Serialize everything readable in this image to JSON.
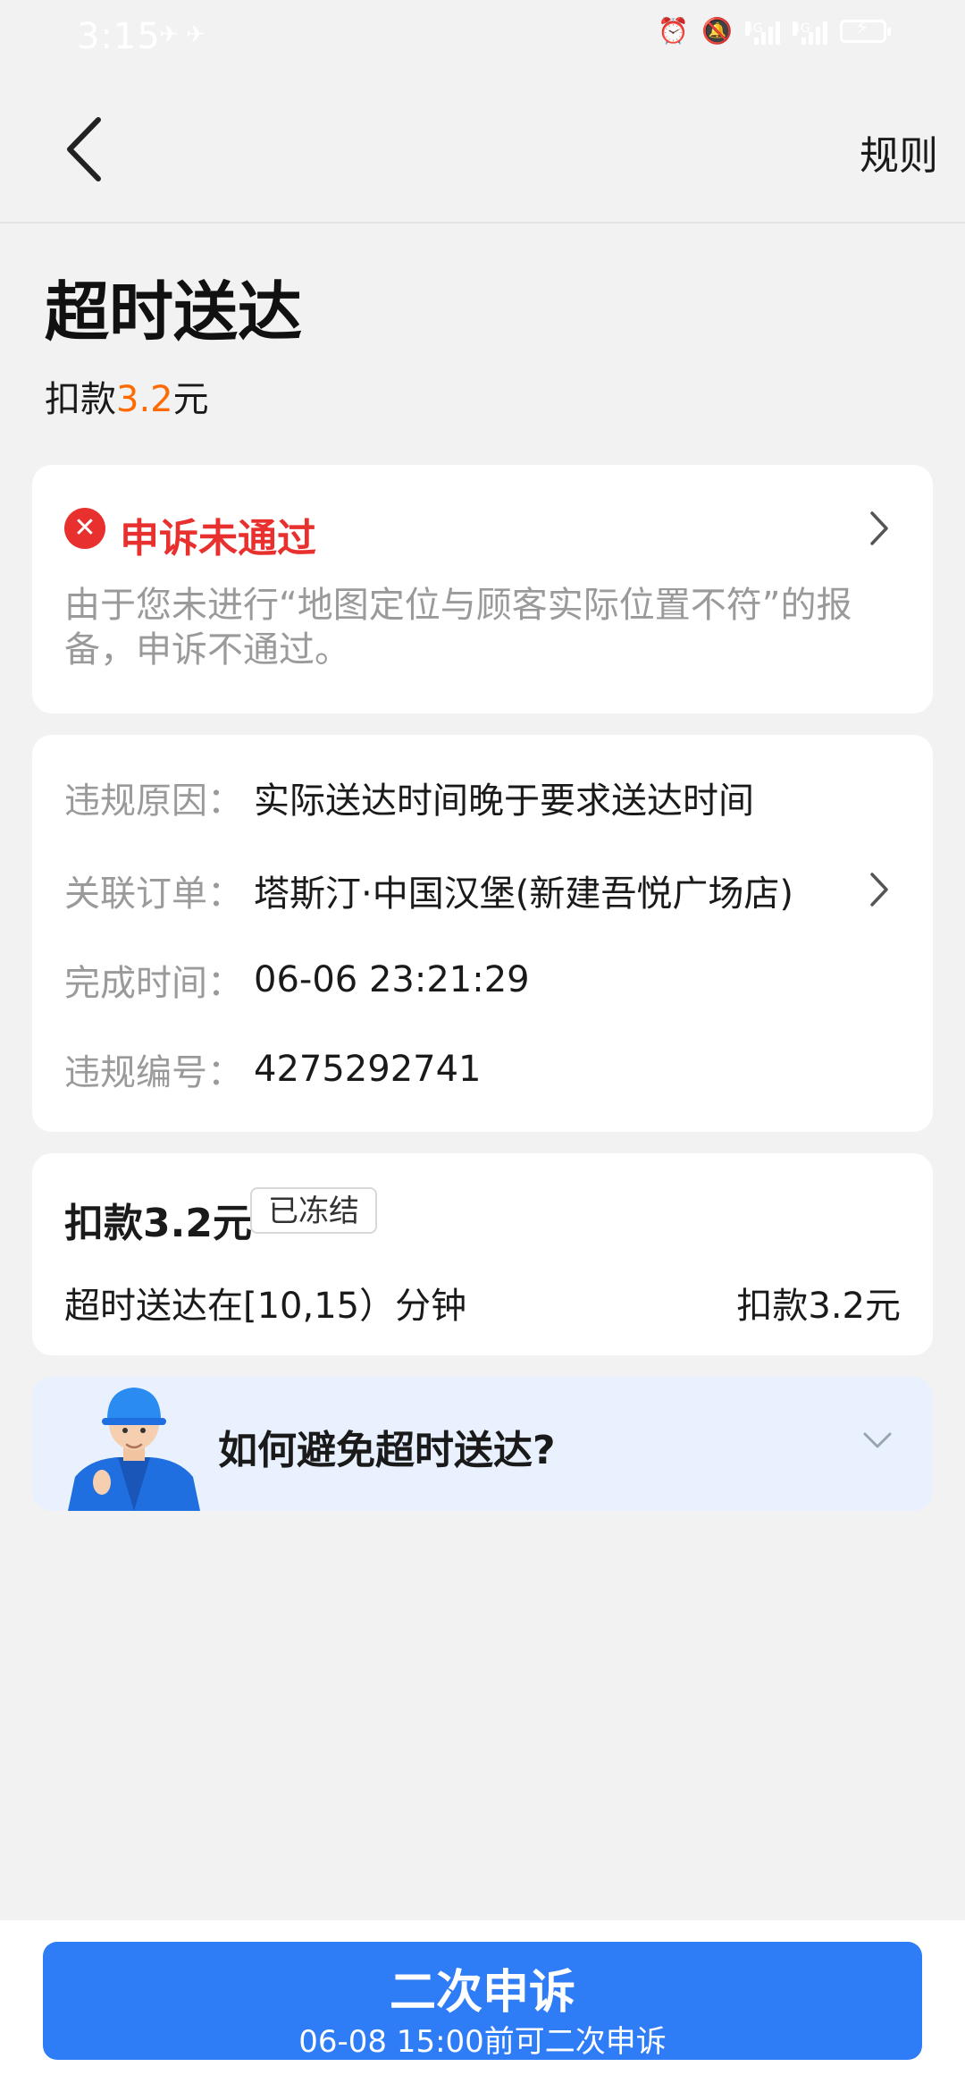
{
  "status_bar": {
    "time": "3:15",
    "network_label_1": "4G",
    "network_label_2": "4G"
  },
  "nav": {
    "rules_label": "规则"
  },
  "header": {
    "title": "超时送达",
    "deduct_prefix": "扣款",
    "deduct_amount": "3.2",
    "deduct_unit": "元"
  },
  "appeal": {
    "status": "申诉未通过",
    "description": "由于您未进行“地图定位与顾客实际位置不符”的报备，申诉不通过。"
  },
  "info": {
    "rows": [
      {
        "label": "违规原因：",
        "value": "实际送达时间晚于要求送达时间"
      },
      {
        "label": "关联订单：",
        "value": "塔斯汀·中国汉堡(新建吾悦广场店)"
      },
      {
        "label": "完成时间：",
        "value": "06-06 23:21:29"
      },
      {
        "label": "违规编号：",
        "value": "4275292741"
      }
    ]
  },
  "penalty": {
    "title": "扣款3.2元",
    "badge": "已冻结",
    "rule": "超时送达在[10,15）分钟",
    "amount": "扣款3.2元"
  },
  "tip": {
    "text": "如何避免超时送达?"
  },
  "cta": {
    "main": "二次申诉",
    "sub": "06-08 15:00前可二次申诉"
  },
  "colors": {
    "accent_blue": "#2f7df6",
    "error_red": "#e8312f",
    "amount_orange": "#ff6a00"
  }
}
